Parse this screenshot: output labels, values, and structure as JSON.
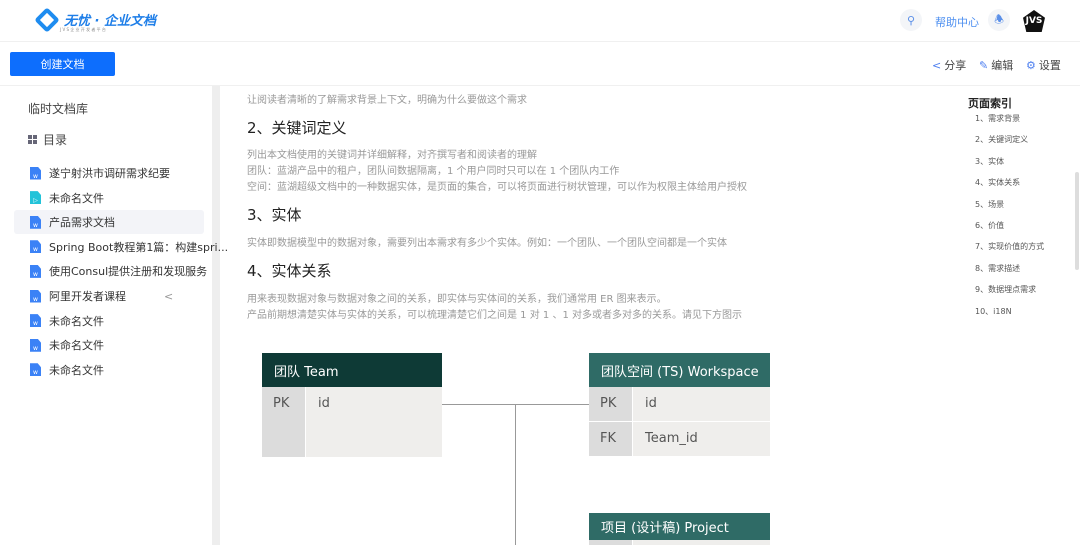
{
  "header": {
    "logo_text": "无忧 · 企业文档",
    "logo_sub": "J V S 企 业 开 发 者 平 台",
    "help": "帮助中心",
    "avatar": "JVS",
    "search_icon": "search-icon",
    "bell_icon": "bell-icon"
  },
  "toolbar": {
    "create": "创建文档",
    "share": "分享",
    "edit": "编辑",
    "settings": "设置"
  },
  "sidebar": {
    "library": "临时文档库",
    "toc": "目录",
    "items": [
      {
        "label": "遂宁射洪市调研需求纪要",
        "icon": "word"
      },
      {
        "label": "未命名文件",
        "icon": "slides"
      },
      {
        "label": "产品需求文档",
        "icon": "word",
        "active": true
      },
      {
        "label": "Spring Boot教程第1篇：构建spri...",
        "icon": "word"
      },
      {
        "label": "使用Consul提供注册和发现服务",
        "icon": "word"
      },
      {
        "label": "阿里开发者课程",
        "icon": "word"
      },
      {
        "label": "未命名文件",
        "icon": "word"
      },
      {
        "label": "未命名文件",
        "icon": "word"
      },
      {
        "label": "未命名文件",
        "icon": "word"
      }
    ]
  },
  "content": {
    "intro": "让阅读者清晰的了解需求背景上下文，明确为什么要做这个需求",
    "h2": "2、关键词定义",
    "p2": [
      "列出本文档使用的关键词并详细解释，对齐撰写者和阅读者的理解",
      "团队：蓝湖产品中的租户，团队间数据隔离，1 个用户同时只可以在 1 个团队内工作",
      "空间：蓝湖超级文档中的一种数据实体，是页面的集合，可以将页面进行树状管理，可以作为权限主体给用户授权"
    ],
    "h3": "3、实体",
    "p3": "实体即数据模型中的数据对象，需要列出本需求有多少个实体。例如：一个团队、一个团队空间都是一个实体",
    "h4": "4、实体关系",
    "p4": [
      "用来表现数据对象与数据对象之间的关系，即实体与实体间的关系，我们通常用 ER 图来表示。",
      "产品前期想清楚实体与实体的关系，可以梳理清楚它们之间是 1 对 1 、1 对多或者多对多的关系。请见下方图示"
    ]
  },
  "diagram": {
    "team": {
      "title": "团队 Team",
      "rows": [
        [
          "PK",
          "id"
        ]
      ],
      "color": "#0e3a36"
    },
    "workspace": {
      "title": "团队空间 (TS) Workspace",
      "rows": [
        [
          "PK",
          "id"
        ],
        [
          "FK",
          "Team_id"
        ]
      ],
      "color": "#2f6b66"
    },
    "project": {
      "title": "项目 (设计稿) Project",
      "color": "#2f6b66"
    }
  },
  "page_index": {
    "title": "页面索引",
    "items": [
      "1、需求背景",
      "2、关键词定义",
      "3、实体",
      "4、实体关系",
      "5、场景",
      "6、价值",
      "7、实现价值的方式",
      "8、需求描述",
      "9、数据埋点需求",
      "10、i18N"
    ]
  }
}
